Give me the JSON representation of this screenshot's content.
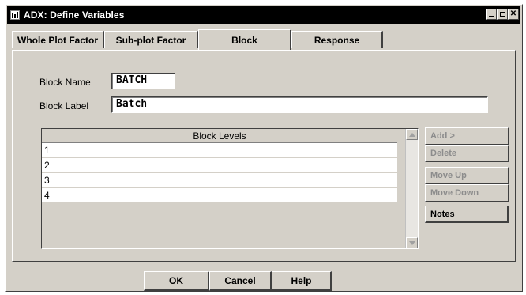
{
  "window": {
    "title": "ADX: Define Variables",
    "title_icon": "sas-app-icon"
  },
  "tabs": [
    {
      "label": "Whole Plot Factor",
      "active": false
    },
    {
      "label": "Sub-plot Factor",
      "active": false
    },
    {
      "label": "Block",
      "active": true
    },
    {
      "label": "Response",
      "active": false
    }
  ],
  "form": {
    "block_name_label": "Block Name",
    "block_name_value": "BATCH",
    "block_label_label": "Block Label",
    "block_label_value": "Batch"
  },
  "levels": {
    "header": "Block Levels",
    "rows": [
      "1",
      "2",
      "3",
      "4"
    ]
  },
  "side_buttons": {
    "add": "Add >",
    "delete": "Delete",
    "move_up": "Move Up",
    "move_down": "Move Down",
    "notes": "Notes"
  },
  "bottom_buttons": {
    "ok": "OK",
    "cancel": "Cancel",
    "help": "Help"
  },
  "colors": {
    "dialog_bg": "#d4d0c8",
    "titlebar_bg": "#000000",
    "disabled_text": "#8c8c8c"
  }
}
